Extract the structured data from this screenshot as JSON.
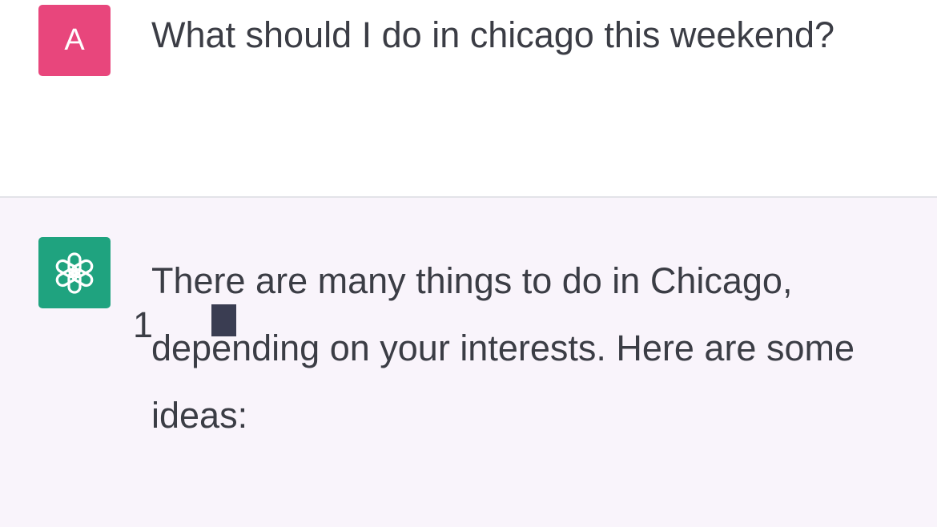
{
  "conversation": {
    "user": {
      "avatar_initial": "A",
      "message": "What should I do in chicago this weekend?"
    },
    "assistant": {
      "avatar_icon": "openai-logo-icon",
      "message": "There are many things to do in Chicago, depending on your interests. Here are some ideas:",
      "list_first_number": "1"
    }
  },
  "colors": {
    "user_avatar": "#e8467c",
    "assistant_avatar": "#1fa37f",
    "assistant_background": "#f9f4fb",
    "text": "#3b3d45"
  }
}
